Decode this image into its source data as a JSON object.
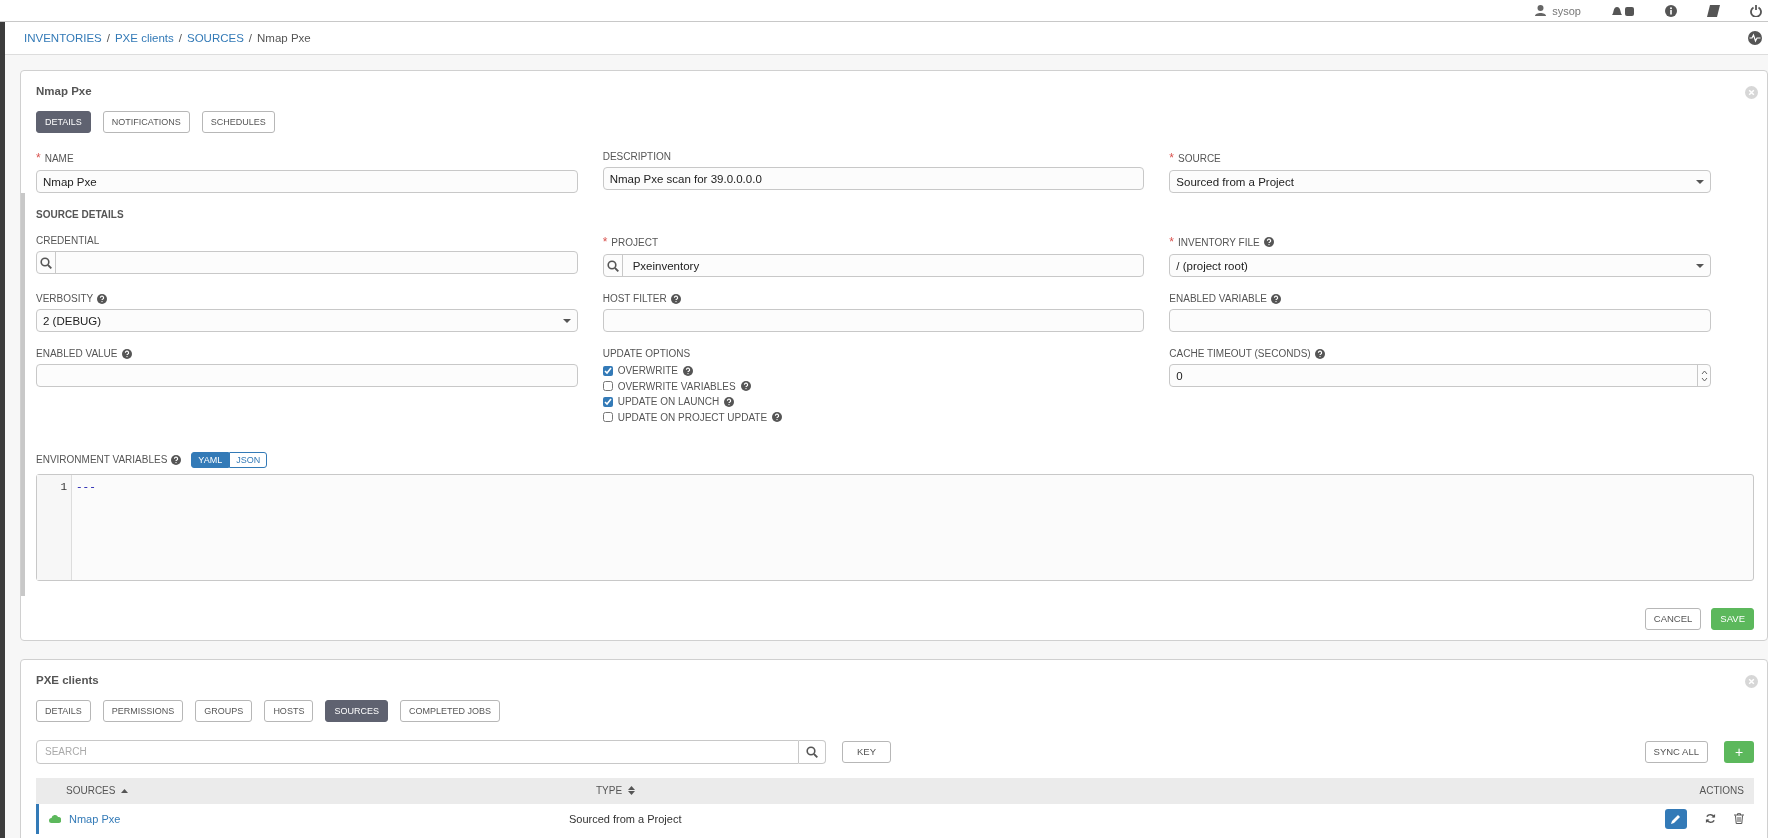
{
  "top_bar": {
    "user": "sysop"
  },
  "breadcrumb": [
    {
      "label": "INVENTORIES",
      "link": true,
      "separator": "/"
    },
    {
      "label": "PXE clients",
      "link": true,
      "separator": "/"
    },
    {
      "label": "SOURCES",
      "link": true,
      "separator": "/"
    },
    {
      "label": "Nmap Pxe",
      "link": false
    }
  ],
  "form": {
    "title": "Nmap Pxe",
    "tabs": [
      {
        "label": "DETAILS",
        "selected": true
      },
      {
        "label": "NOTIFICATIONS",
        "selected": false
      },
      {
        "label": "SCHEDULES",
        "selected": false
      }
    ],
    "fields": [
      {
        "label": "NAME",
        "kind": "text",
        "required_mark": "*",
        "value": "Nmap Pxe"
      },
      {
        "label": "DESCRIPTION",
        "kind": "text",
        "value": "Nmap Pxe scan for 39.0.0.0.0"
      },
      {
        "label": "SOURCE",
        "kind": "select",
        "required_mark": "*",
        "value": "Sourced from a Project"
      }
    ],
    "section_title": "SOURCE DETAILS",
    "source_fields": [
      {
        "label": "CREDENTIAL",
        "kind": "lookup"
      },
      {
        "label": "PROJECT",
        "kind": "lookup",
        "required_mark": "*",
        "value": "Pxeinventory"
      },
      {
        "label": "INVENTORY FILE",
        "kind": "select",
        "required_mark": "*",
        "help": true,
        "value": "/ (project root)"
      },
      {
        "label": "VERBOSITY",
        "kind": "select",
        "help": true,
        "value": "2 (DEBUG)"
      },
      {
        "label": "HOST FILTER",
        "kind": "text",
        "help": true
      },
      {
        "label": "ENABLED VARIABLE",
        "kind": "text",
        "help": true
      },
      {
        "label": "ENABLED VALUE",
        "kind": "text",
        "help": true
      },
      {
        "label": "UPDATE OPTIONS",
        "kind": "checkboxes",
        "options": [
          {
            "label": "OVERWRITE",
            "checked": true,
            "help": true
          },
          {
            "label": "OVERWRITE VARIABLES",
            "checked": false,
            "help": true
          },
          {
            "label": "UPDATE ON LAUNCH",
            "checked": true,
            "help": true
          },
          {
            "label": "UPDATE ON PROJECT UPDATE",
            "checked": false,
            "help": true
          }
        ]
      },
      {
        "label": "CACHE TIMEOUT (SECONDS)",
        "kind": "number",
        "help": true,
        "value": "0"
      }
    ],
    "environment_variables": {
      "label": "ENVIRONMENT VARIABLES",
      "help": true,
      "modes": [
        {
          "label": "YAML",
          "selected": true
        },
        {
          "label": "JSON",
          "selected": false
        }
      ],
      "lines": [
        {
          "number": "1",
          "text": "---"
        }
      ]
    },
    "buttons": [
      {
        "label": "CANCEL",
        "kind": "secondary"
      },
      {
        "label": "SAVE",
        "kind": "primary"
      }
    ]
  },
  "inventory": {
    "title": "PXE clients",
    "tabs": [
      {
        "label": "DETAILS",
        "selected": false
      },
      {
        "label": "PERMISSIONS",
        "selected": false
      },
      {
        "label": "GROUPS",
        "selected": false
      },
      {
        "label": "HOSTS",
        "selected": false
      },
      {
        "label": "SOURCES",
        "selected": true
      },
      {
        "label": "COMPLETED JOBS",
        "selected": false
      }
    ],
    "search": {
      "placeholder": "SEARCH"
    },
    "key_button": "KEY",
    "sync_button": "SYNC ALL",
    "add_button": "+",
    "table": {
      "columns": [
        {
          "label": "SOURCES",
          "sortable": true,
          "sorted": true
        },
        {
          "label": "TYPE",
          "sortable": true
        },
        {
          "label": "ACTIONS"
        }
      ],
      "rows": [
        {
          "name": "Nmap Pxe",
          "type": "Sourced from a Project",
          "selected": true
        }
      ]
    }
  }
}
